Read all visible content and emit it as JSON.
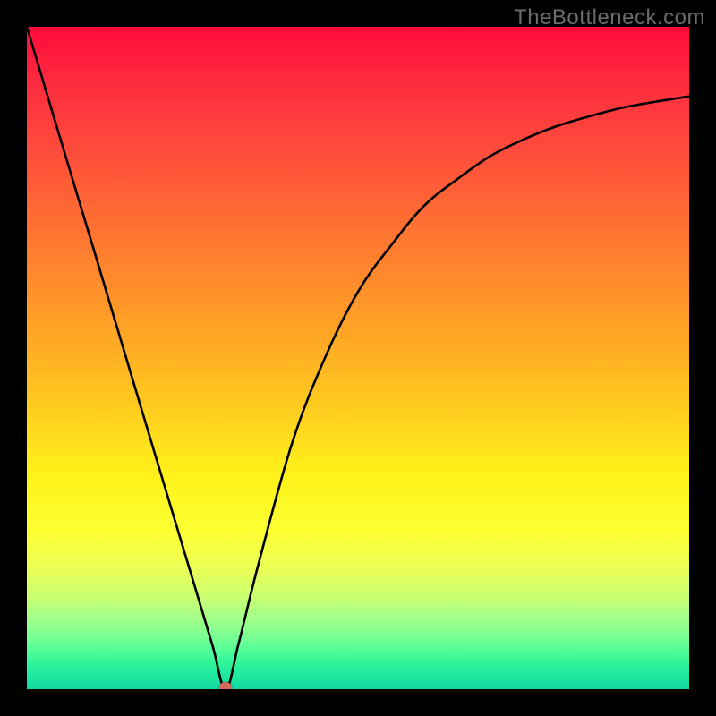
{
  "watermark": "TheBottleneck.com",
  "marker": {
    "color": "#d46a5a"
  },
  "chart_data": {
    "type": "line",
    "title": "",
    "xlabel": "",
    "ylabel": "",
    "xlim": [
      0,
      100
    ],
    "ylim": [
      0,
      100
    ],
    "grid": false,
    "legend": false,
    "min_point": {
      "x": 30,
      "y": 0
    },
    "series": [
      {
        "name": "bottleneck-curve",
        "x": [
          0,
          5,
          10,
          15,
          20,
          25,
          28,
          30,
          32,
          35,
          40,
          45,
          50,
          55,
          60,
          65,
          70,
          75,
          80,
          85,
          90,
          95,
          100
        ],
        "y": [
          100,
          83.3,
          66.7,
          50,
          33.3,
          16.7,
          6.7,
          0,
          7,
          19,
          37,
          50,
          60,
          67,
          73,
          77,
          80.5,
          83,
          85,
          86.5,
          87.8,
          88.7,
          89.5
        ]
      }
    ],
    "annotations": []
  }
}
